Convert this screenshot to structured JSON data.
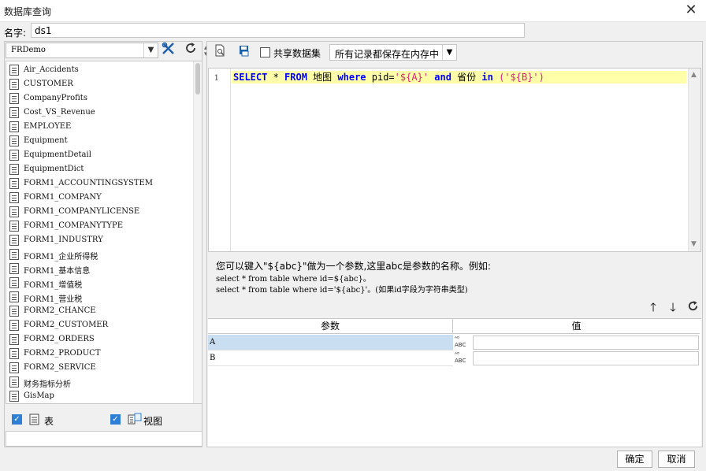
{
  "window": {
    "title": "数据库查询",
    "close_glyph": "✕"
  },
  "name_field": {
    "label": "名字:",
    "value": "ds1"
  },
  "left_panel": {
    "database": "FRDemo",
    "tables": [
      "Air_Accidents",
      "CUSTOMER",
      "CompanyProfits",
      "Cost_VS_Revenue",
      "EMPLOYEE",
      "Equipment",
      "EquipmentDetail",
      "EquipmentDict",
      "FORM1_ACCOUNTINGSYSTEM",
      "FORM1_COMPANY",
      "FORM1_COMPANYLICENSE",
      "FORM1_COMPANYTYPE",
      "FORM1_INDUSTRY",
      "FORM1_企业所得税",
      "FORM1_基本信息",
      "FORM1_增值税",
      "FORM1_营业税",
      "FORM2_CHANCE",
      "FORM2_CUSTOMER",
      "FORM2_ORDERS",
      "FORM2_PRODUCT",
      "FORM2_SERVICE",
      "财务指标分析",
      "GisMap"
    ],
    "table_option": "表",
    "view_option": "视图",
    "icons": {
      "config": "tools-icon",
      "refresh": "refresh-icon"
    }
  },
  "toolbar": {
    "share_label": "共享数据集",
    "memory_option": "所有记录都保存在内存中"
  },
  "editor": {
    "line_number": "1",
    "tokens": [
      {
        "t": "SELECT",
        "c": "kw"
      },
      {
        "t": " * ",
        "c": ""
      },
      {
        "t": "FROM",
        "c": "kw"
      },
      {
        "t": " 地图 ",
        "c": ""
      },
      {
        "t": "where",
        "c": "kw"
      },
      {
        "t": " pid=",
        "c": ""
      },
      {
        "t": "'${A}'",
        "c": "str"
      },
      {
        "t": " ",
        "c": ""
      },
      {
        "t": "and",
        "c": "kw"
      },
      {
        "t": " 省份 ",
        "c": ""
      },
      {
        "t": "in",
        "c": "kw"
      },
      {
        "t": " (",
        "c": "str"
      },
      {
        "t": "'${B}'",
        "c": "str"
      },
      {
        "t": ")",
        "c": "str"
      }
    ]
  },
  "help": {
    "line1": "您可以键入\"${abc}\"做为一个参数,这里abc是参数的名称。例如:",
    "line2": "select * from table where id=${abc}。",
    "line3": "select * from table where id='${abc}'。(如果id字段为字符串类型)"
  },
  "params": {
    "headers": [
      "参数",
      "值"
    ],
    "rows": [
      {
        "name": "A",
        "value": ""
      },
      {
        "name": "B",
        "value": ""
      }
    ],
    "type_glyph_top": "ᴬ⁸",
    "type_glyph_bottom": "ABC"
  },
  "buttons": {
    "ok": "确定",
    "cancel": "取消"
  }
}
